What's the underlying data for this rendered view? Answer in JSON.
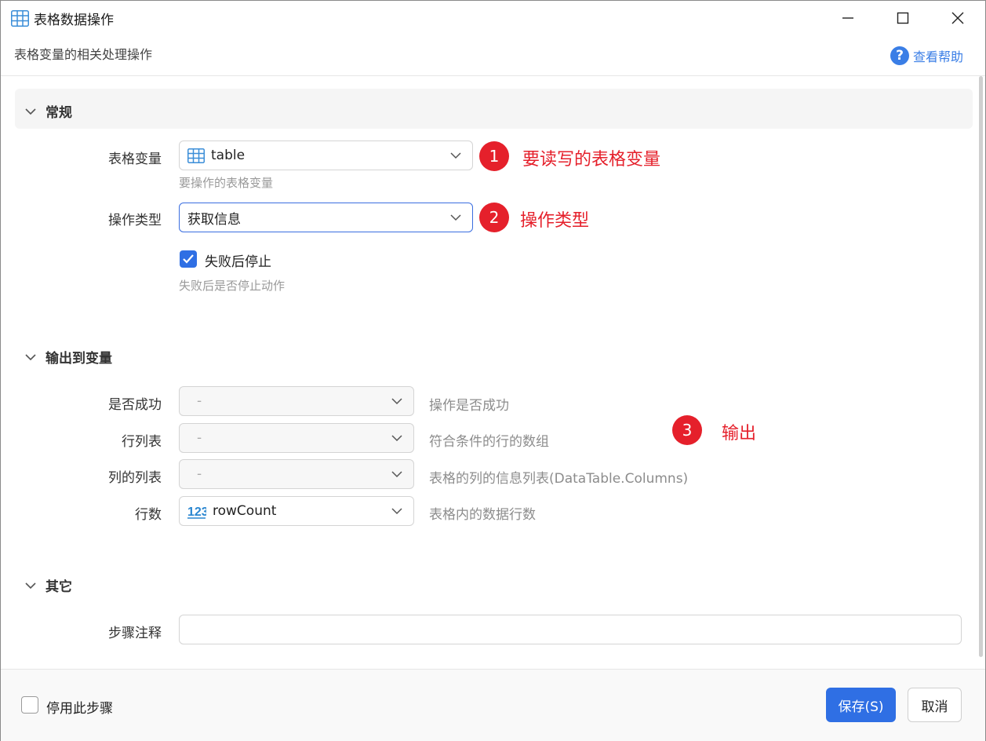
{
  "window": {
    "title": "表格数据操作",
    "subtitle": "表格变量的相关处理操作",
    "help_label": "查看帮助"
  },
  "sections": {
    "general": "常规",
    "output": "输出到变量",
    "other": "其它"
  },
  "general": {
    "table_var": {
      "label": "表格变量",
      "value": "table",
      "icon": "table-icon",
      "hint": "要操作的表格变量"
    },
    "op_type": {
      "label": "操作类型",
      "value": "获取信息"
    },
    "stop_on_fail": {
      "label": "失败后停止",
      "checked": true,
      "hint": "失败后是否停止动作"
    }
  },
  "output": {
    "rows": [
      {
        "label": "是否成功",
        "value": "-",
        "desc": "操作是否成功"
      },
      {
        "label": "行列表",
        "value": "-",
        "desc": "符合条件的行的数组"
      },
      {
        "label": "列的列表",
        "value": "-",
        "desc": "表格的列的信息列表(DataTable.Columns)"
      },
      {
        "label": "行数",
        "value": "rowCount",
        "icon": "number-123-icon",
        "desc": "表格内的数据行数"
      }
    ]
  },
  "other": {
    "step_note_label": "步骤注释",
    "step_note_value": ""
  },
  "annotations": [
    {
      "num": "1",
      "text": "要读写的表格变量"
    },
    {
      "num": "2",
      "text": "操作类型"
    },
    {
      "num": "3",
      "text": "输出"
    }
  ],
  "footer": {
    "disable_label": "停用此步骤",
    "disable_checked": false,
    "save_label": "保存(S)",
    "cancel_label": "取消"
  },
  "colors": {
    "accent": "#2f6fe4",
    "annotation": "#e5202b",
    "help": "#3a7ee6"
  }
}
